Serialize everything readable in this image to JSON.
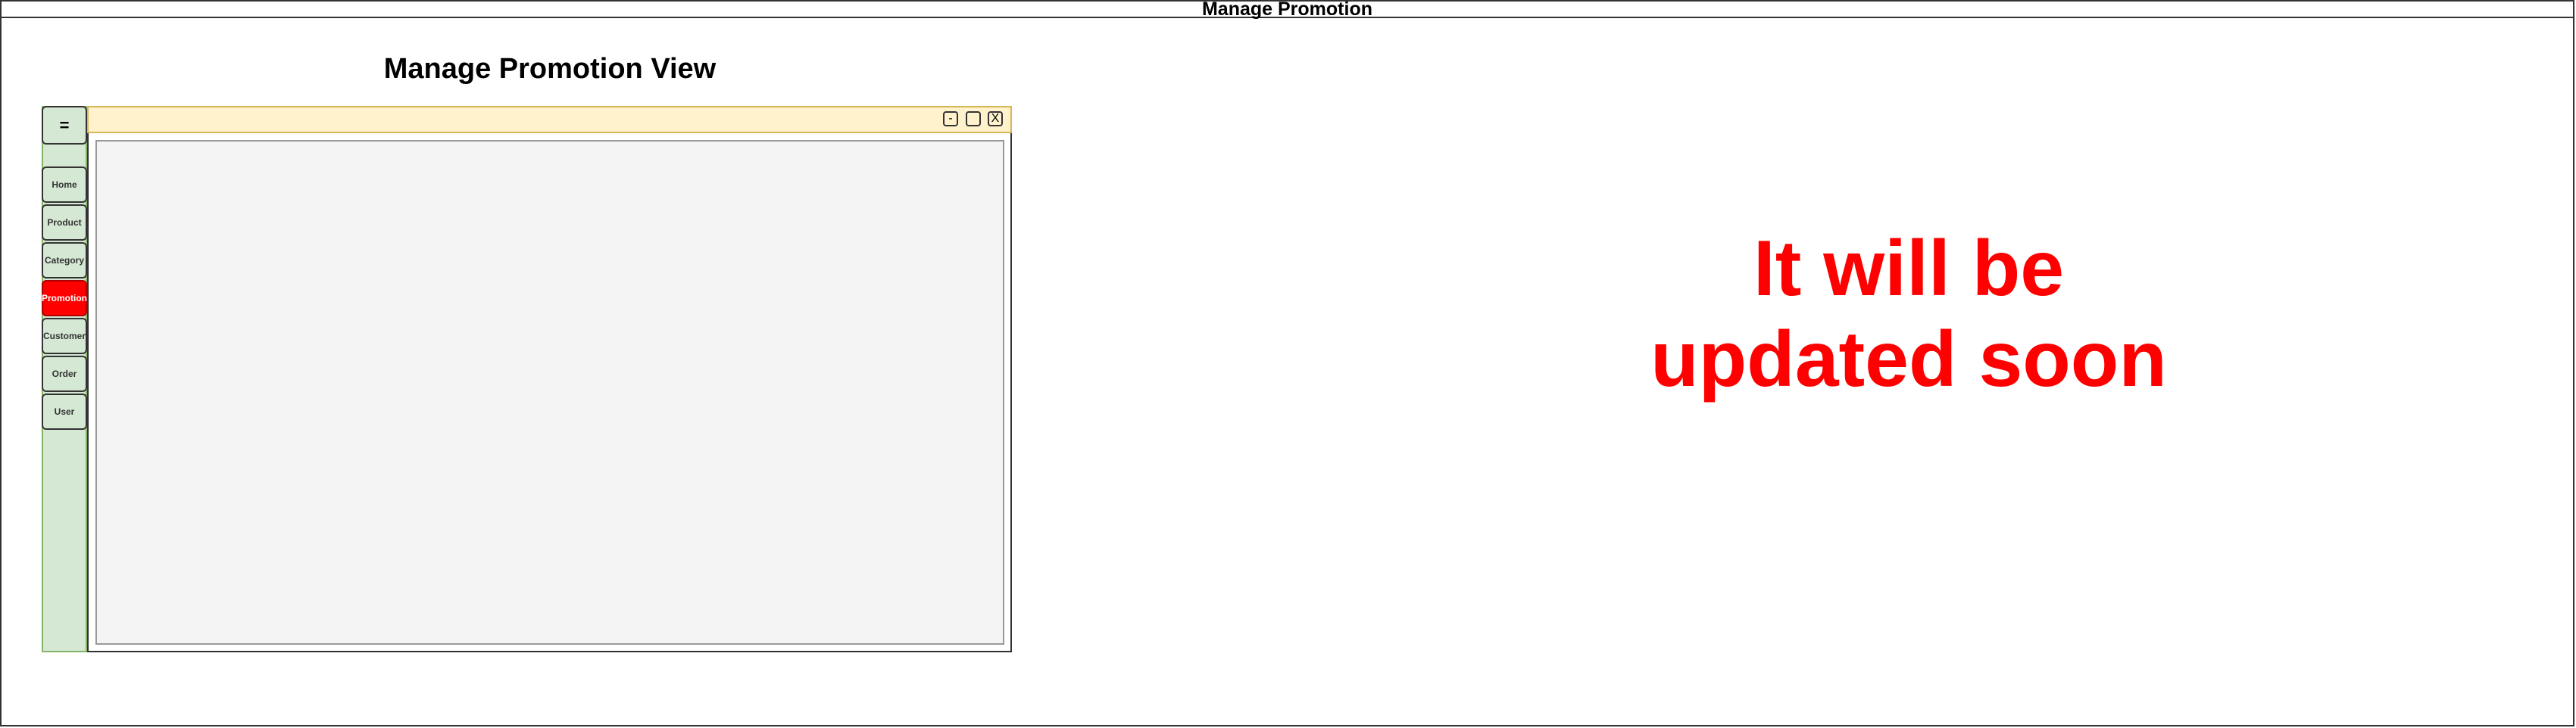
{
  "page": {
    "frame_title": "Manage Promotion",
    "view_title": "Manage Promotion View"
  },
  "sidebar": {
    "menu_label": "=",
    "items": [
      {
        "label": "Home"
      },
      {
        "label": "Product"
      },
      {
        "label": "Category"
      },
      {
        "label": "Promotion"
      },
      {
        "label": "Customer"
      },
      {
        "label": "Order"
      },
      {
        "label": "User"
      }
    ],
    "active_item": "Promotion"
  },
  "window": {
    "minimize_label": "-",
    "close_label": "X"
  },
  "notice": {
    "line1": "It will be",
    "line2": "updated soon"
  },
  "colors": {
    "sidebar": "#d5e8d4",
    "titlebar": "#fff2cc",
    "active_item": "#ff0000",
    "notice_text": "#ff0000"
  }
}
